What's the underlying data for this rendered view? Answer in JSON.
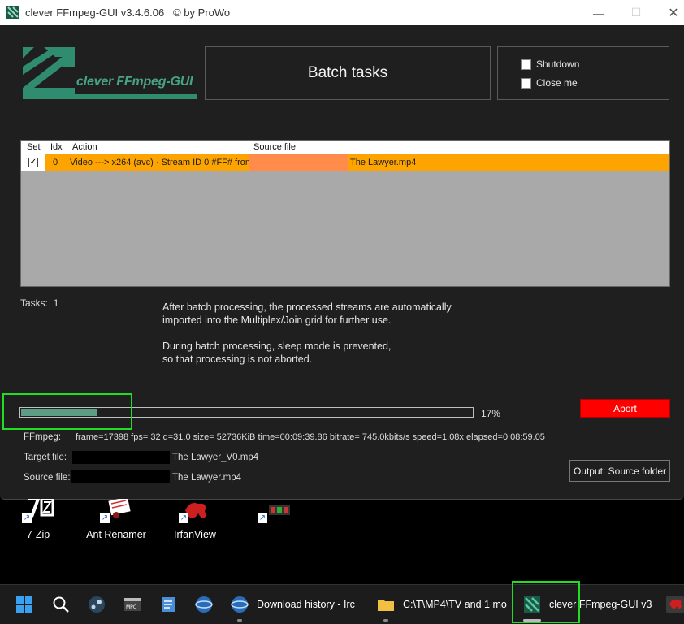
{
  "window": {
    "title": "clever FFmpeg-GUI v3.4.6.06",
    "copyright": "© by ProWo",
    "controls": {
      "minimize": "—",
      "maximize": "☐",
      "close": "✕"
    }
  },
  "logo": {
    "text": "clever FFmpeg-GUI"
  },
  "header": {
    "batch_title": "Batch tasks"
  },
  "options": {
    "shutdown": {
      "label": "Shutdown",
      "checked": false
    },
    "close_me": {
      "label": "Close me",
      "checked": false
    }
  },
  "grid": {
    "columns": [
      "Set",
      "Idx",
      "Action",
      "Source file"
    ],
    "rows": [
      {
        "set": "✓",
        "idx": "0",
        "action": "Video ---> x264 (avc) · Stream ID 0 #FF# from",
        "source": "The Lawyer.mp4"
      }
    ]
  },
  "tasks": {
    "label": "Tasks:",
    "count": "1"
  },
  "info": {
    "line1": "After batch processing, the processed streams are automatically",
    "line2": "imported into the Multiplex/Join grid for further use.",
    "line3": "During batch processing, sleep mode is prevented,",
    "line4": "so that processing is not aborted."
  },
  "progress": {
    "percent_label": "17%",
    "fraction": 0.17
  },
  "abort_label": "Abort",
  "ffmpeg": {
    "label": "FFmpeg:",
    "status": "frame=17398 fps= 32 q=31.0 size=   52736KiB time=00:09:39.86 bitrate= 745.0kbits/s speed=1.08x elapsed=0:08:59.05"
  },
  "target": {
    "label": "Target file:",
    "name": "The Lawyer_V0.mp4"
  },
  "source": {
    "label": "Source file:",
    "name": "The Lawyer.mp4"
  },
  "output_button": "Output: Source folder",
  "desktop_icons": [
    {
      "label": "7-Zip",
      "icon": "7zip-icon"
    },
    {
      "label": "Ant Renamer",
      "icon": "ant-renamer-icon"
    },
    {
      "label": "IrfanView",
      "icon": "irfanview-icon"
    },
    {
      "label": "",
      "icon": "app-shortcut-icon"
    }
  ],
  "taskbar": {
    "items": [
      {
        "icon": "windows-start-icon"
      },
      {
        "icon": "search-icon"
      },
      {
        "icon": "steam-icon"
      },
      {
        "icon": "mpc-be-icon"
      },
      {
        "icon": "notepad-icon"
      },
      {
        "icon": "browser-icon"
      },
      {
        "icon": "browser-download-icon",
        "label": "Download history - Irc"
      },
      {
        "icon": "folder-icon",
        "label": "C:\\T\\MP4\\TV and 1 mo"
      },
      {
        "icon": "ffmpeg-gui-icon",
        "label": "clever FFmpeg-GUI v3"
      },
      {
        "icon": "irfanview-icon"
      }
    ]
  },
  "colors": {
    "window_bg": "#1f1f1f",
    "accent_green": "#47a386",
    "row_highlight": "#fda400",
    "abort_red": "#ff0000",
    "highlight_box": "#22dd22"
  }
}
